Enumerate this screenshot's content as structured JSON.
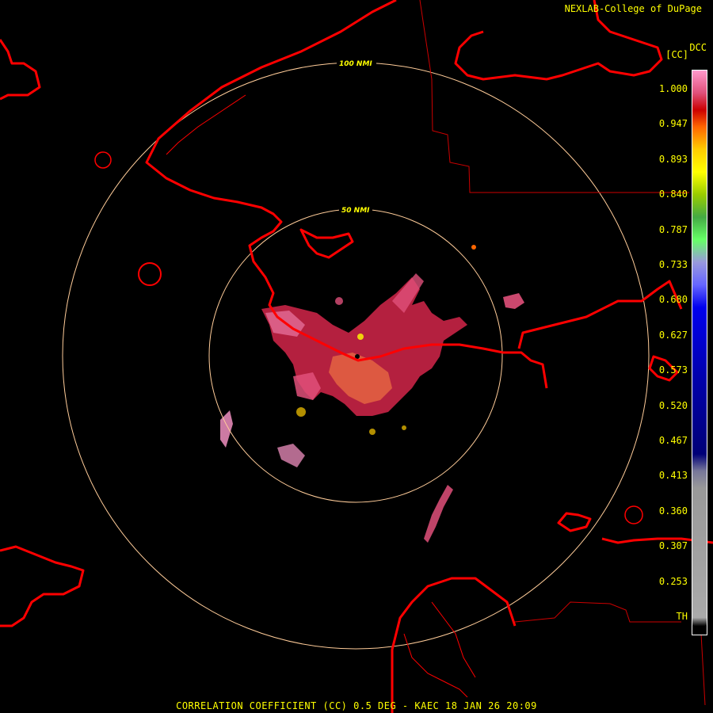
{
  "header": {
    "credit": "NEXLAB-College of DuPage",
    "product_code": "DCC",
    "unit": "[CC]"
  },
  "range_rings": [
    {
      "label": "50 NMI"
    },
    {
      "label": "100 NMI"
    }
  ],
  "colorbar": {
    "ticks": [
      "1.000",
      "0.947",
      "0.893",
      "0.840",
      "0.787",
      "0.733",
      "0.680",
      "0.627",
      "0.573",
      "0.520",
      "0.467",
      "0.413",
      "0.360",
      "0.307",
      "0.253",
      "TH"
    ],
    "stops": [
      {
        "color": "#ff99cc",
        "frac": 0.0
      },
      {
        "color": "#e0507a",
        "frac": 0.04
      },
      {
        "color": "#cc0000",
        "frac": 0.07
      },
      {
        "color": "#ff6600",
        "frac": 0.1
      },
      {
        "color": "#ffcc00",
        "frac": 0.14
      },
      {
        "color": "#ffff00",
        "frac": 0.18
      },
      {
        "color": "#99cc00",
        "frac": 0.22
      },
      {
        "color": "#44aa44",
        "frac": 0.26
      },
      {
        "color": "#66ff66",
        "frac": 0.3
      },
      {
        "color": "#9999dd",
        "frac": 0.34
      },
      {
        "color": "#6666ff",
        "frac": 0.38
      },
      {
        "color": "#0000ee",
        "frac": 0.42
      },
      {
        "color": "#0000aa",
        "frac": 0.55
      },
      {
        "color": "#000077",
        "frac": 0.68
      },
      {
        "color": "#777799",
        "frac": 0.71
      },
      {
        "color": "#999999",
        "frac": 0.74
      },
      {
        "color": "#aaaaaa",
        "frac": 0.97
      },
      {
        "color": "#000000",
        "frac": 0.985
      }
    ]
  },
  "footer": {
    "caption": "CORRELATION COEFFICIENT (CC) 0.5 DEG - KAEC 18 JAN 26 20:09"
  },
  "colors": {
    "background": "#000000",
    "coastline": "#ff0000",
    "borders": "#cc0000",
    "rings": "#ffcc99",
    "text": "#ffff00"
  }
}
